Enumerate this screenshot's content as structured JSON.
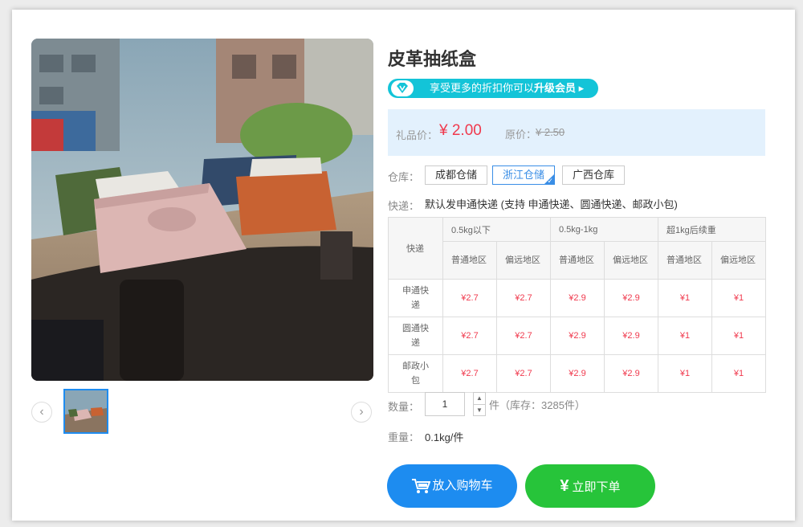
{
  "product": {
    "title": "皮革抽纸盒"
  },
  "vip": {
    "text": "享受更多的折扣你可以",
    "upgrade": "升级会员"
  },
  "price": {
    "label": "礼品价：",
    "value": "¥ 2.00",
    "orig_label": "原价：",
    "orig_value": "¥ 2.50"
  },
  "warehouse": {
    "label": "仓库：",
    "options": [
      "成都仓储",
      "浙江仓储",
      "广西仓库"
    ],
    "selected": "浙江仓储"
  },
  "shipping": {
    "label": "快递：",
    "text": "默认发申通快递 (支持 申通快递、圆通快递、邮政小包)",
    "table": {
      "corner": "快递",
      "groups": [
        "0.5kg以下",
        "0.5kg-1kg",
        "超1kg后续重"
      ],
      "subheaders": [
        "普通地区",
        "偏远地区",
        "普通地区",
        "偏远地区",
        "普通地区",
        "偏远地区"
      ],
      "rows": [
        {
          "name": "申通快递",
          "values": [
            "¥2.7",
            "¥2.7",
            "¥2.9",
            "¥2.9",
            "¥1",
            "¥1"
          ]
        },
        {
          "name": "圆通快递",
          "values": [
            "¥2.7",
            "¥2.7",
            "¥2.9",
            "¥2.9",
            "¥1",
            "¥1"
          ]
        },
        {
          "name": "邮政小包",
          "values": [
            "¥2.7",
            "¥2.7",
            "¥2.9",
            "¥2.9",
            "¥1",
            "¥1"
          ]
        }
      ]
    }
  },
  "quantity": {
    "label": "数量：",
    "value": "1",
    "stock": "件（库存：3285件）"
  },
  "weight": {
    "label": "重量：",
    "value": "0.1kg/件"
  },
  "buttons": {
    "cart": "放入购物车",
    "buy": "立即下单"
  },
  "icons": {
    "prev": "chevron-left-icon",
    "next": "chevron-right-icon",
    "cart": "cart-icon",
    "yen": "yen-icon",
    "vip": "diamond-icon"
  },
  "colors": {
    "accent": "#1d8cf0",
    "price": "#f0394d",
    "buy": "#27c43a",
    "vip": "#13c4d8"
  }
}
